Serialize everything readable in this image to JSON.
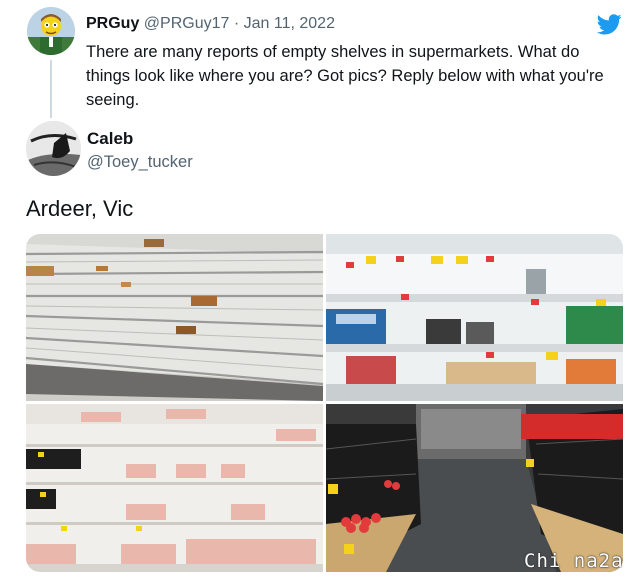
{
  "parent_tweet": {
    "display_name": "PRGuy",
    "handle": "@PRGuy17",
    "separator": "·",
    "date": "Jan 11, 2022",
    "text": "There are many reports of empty shelves in supermarkets. What do things look like where you are? Got pics? Reply below with what you're seeing."
  },
  "reply_tweet": {
    "display_name": "Caleb",
    "handle": "@Toey_tucker",
    "text": "Ardeer, Vic"
  },
  "icons": {
    "brand": "twitter-bird-icon",
    "brand_color": "#1d9bf0"
  },
  "photos": [
    {
      "subject": "empty-bread-shelves"
    },
    {
      "subject": "empty-grocery-shelves"
    },
    {
      "subject": "meat-fridge-shelves"
    },
    {
      "subject": "empty-produce-bins"
    }
  ],
  "watermark": "Chi na2a"
}
